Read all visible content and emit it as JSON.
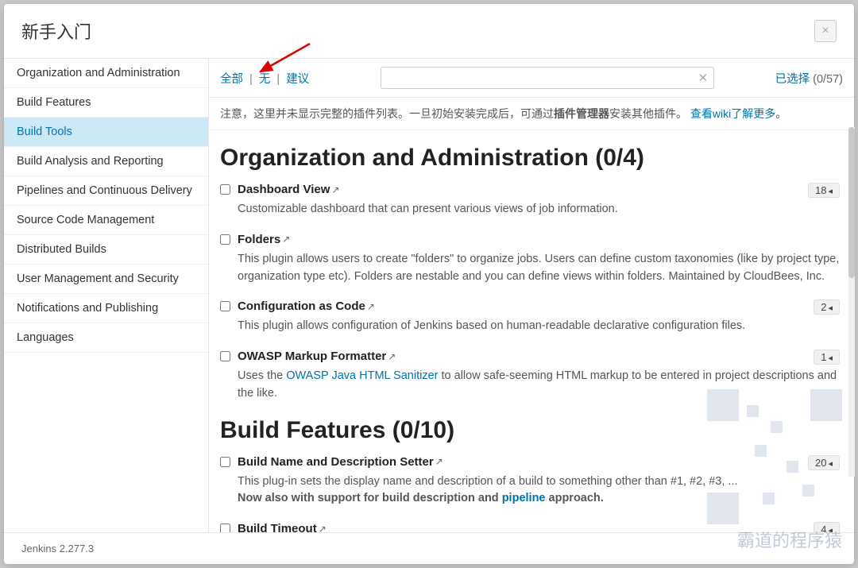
{
  "modal": {
    "title": "新手入门"
  },
  "sidebar": {
    "items": [
      {
        "label": "Organization and Administration"
      },
      {
        "label": "Build Features"
      },
      {
        "label": "Build Tools"
      },
      {
        "label": "Build Analysis and Reporting"
      },
      {
        "label": "Pipelines and Continuous Delivery"
      },
      {
        "label": "Source Code Management"
      },
      {
        "label": "Distributed Builds"
      },
      {
        "label": "User Management and Security"
      },
      {
        "label": "Notifications and Publishing"
      },
      {
        "label": "Languages"
      }
    ],
    "activeIndex": 2
  },
  "toolbar": {
    "filter_all": "全部",
    "filter_none": "无",
    "filter_suggest": "建议",
    "selected_label": "已选择",
    "selected_count": "(0/57)"
  },
  "notice": {
    "prefix": "注意，这里并未显示完整的插件列表。一旦初始安装完成后，可通过",
    "bold": "插件管理器",
    "mid": "安装其他插件。",
    "link": "查看wiki了解更多",
    "suffix": "。"
  },
  "sections": [
    {
      "title": "Organization and Administration (0/4)",
      "plugins": [
        {
          "name": "Dashboard View",
          "badge": "18",
          "desc_plain": "Customizable dashboard that can present various views of job information."
        },
        {
          "name": "Folders",
          "desc_plain": "This plugin allows users to create \"folders\" to organize jobs. Users can define custom taxonomies (like by project type, organization type etc). Folders are nestable and you can define views within folders. Maintained by CloudBees, Inc."
        },
        {
          "name": "Configuration as Code",
          "badge": "2",
          "desc_plain": "This plugin allows configuration of Jenkins based on human-readable declarative configuration files."
        },
        {
          "name": "OWASP Markup Formatter",
          "badge": "1",
          "desc_pre": "Uses the ",
          "desc_link": "OWASP Java HTML Sanitizer",
          "desc_post": " to allow safe-seeming HTML markup to be entered in project descriptions and the like."
        }
      ]
    },
    {
      "title": "Build Features (0/10)",
      "plugins": [
        {
          "name": "Build Name and Description Setter",
          "badge": "20",
          "desc_pre": "This plug-in sets the display name and description of a build to something other than #1, #2, #3, ...",
          "desc_bold_pre": "Now also with support for build description and ",
          "desc_link": "pipeline",
          "desc_bold_post": " approach."
        },
        {
          "name": "Build Timeout",
          "badge": "4"
        }
      ]
    }
  ],
  "footer": {
    "version": "Jenkins 2.277.3"
  },
  "watermark": "霸道的程序猿"
}
